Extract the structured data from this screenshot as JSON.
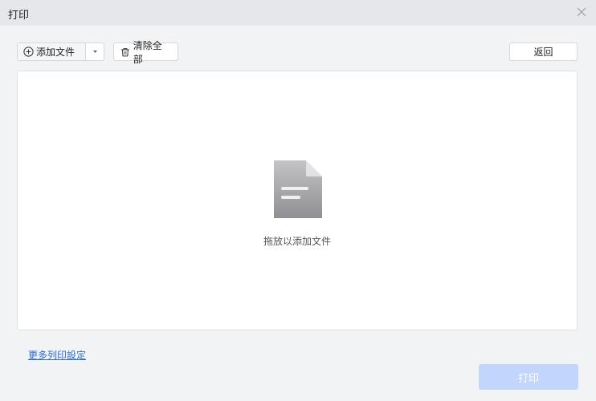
{
  "window": {
    "title": "打印"
  },
  "toolbar": {
    "add_file_label": "添加文件",
    "clear_all_label": "清除全部",
    "back_label": "返回"
  },
  "dropzone": {
    "hint": "拖放以添加文件"
  },
  "footer": {
    "more_settings": "更多列印設定",
    "print_label": "打印"
  },
  "colors": {
    "link": "#2d6ad8",
    "print_button_disabled": "#c2d6fb",
    "titlebar": "#e6e7eb"
  },
  "icons": [
    "close-icon",
    "add-circle-icon",
    "dropdown-arrow-icon",
    "trash-icon",
    "document-icon"
  ]
}
